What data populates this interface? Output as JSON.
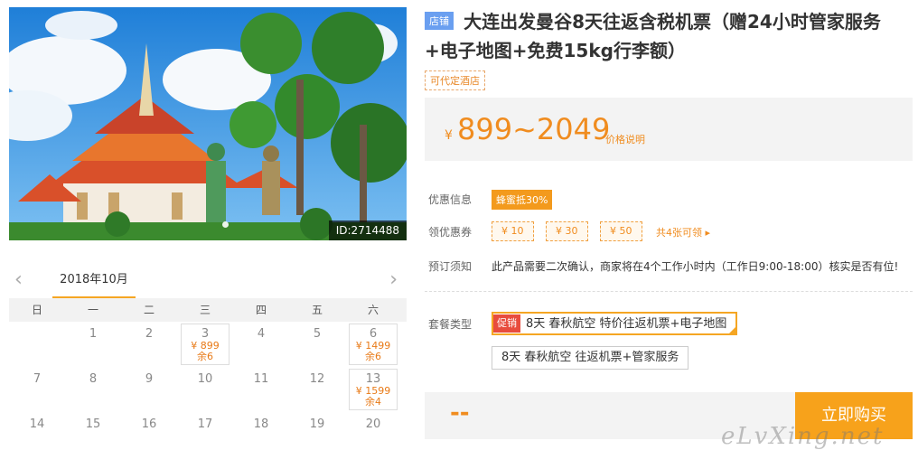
{
  "photo": {
    "id_label": "ID:2714488"
  },
  "calendar": {
    "month": "2018年10月",
    "prev": "‹",
    "next": "›",
    "weekdays": [
      "日",
      "一",
      "二",
      "三",
      "四",
      "五",
      "六"
    ],
    "days": [
      {
        "day": "",
        "price": "",
        "stock": ""
      },
      {
        "day": "1",
        "price": "",
        "stock": ""
      },
      {
        "day": "2",
        "price": "",
        "stock": ""
      },
      {
        "day": "3",
        "price": "¥ 899",
        "stock": "余6"
      },
      {
        "day": "4",
        "price": "",
        "stock": ""
      },
      {
        "day": "5",
        "price": "",
        "stock": ""
      },
      {
        "day": "6",
        "price": "¥ 1499",
        "stock": "余6"
      },
      {
        "day": "7",
        "price": "",
        "stock": ""
      },
      {
        "day": "8",
        "price": "",
        "stock": ""
      },
      {
        "day": "9",
        "price": "",
        "stock": ""
      },
      {
        "day": "10",
        "price": "",
        "stock": ""
      },
      {
        "day": "11",
        "price": "",
        "stock": ""
      },
      {
        "day": "12",
        "price": "",
        "stock": ""
      },
      {
        "day": "13",
        "price": "¥ 1599",
        "stock": "余4"
      },
      {
        "day": "14",
        "price": "",
        "stock": ""
      },
      {
        "day": "15",
        "price": "",
        "stock": ""
      },
      {
        "day": "16",
        "price": "",
        "stock": ""
      },
      {
        "day": "17",
        "price": "",
        "stock": ""
      },
      {
        "day": "18",
        "price": "",
        "stock": ""
      },
      {
        "day": "19",
        "price": "",
        "stock": ""
      },
      {
        "day": "20",
        "price": "",
        "stock": ""
      }
    ]
  },
  "product": {
    "store_badge": "店铺",
    "title": "大连出发曼谷8天往返含税机票（赠24小时管家服务+电子地图+免费15kg行李额）",
    "hotel_tag": "可代定酒店",
    "price_symbol": "¥",
    "price_range": "899~2049",
    "price_explain": "价格说明"
  },
  "offers": {
    "promo_label": "优惠信息",
    "promo_tag": "蜂蜜抵30%",
    "coupon_label": "领优惠券",
    "coupons": [
      "¥ 10",
      "¥ 30",
      "¥ 50"
    ],
    "coupon_more": "共4张可领 ▸",
    "notice_label": "预订须知",
    "notice_text": "此产品需要二次确认，商家将在4个工作小时内（工作日9:00-18:00）核实是否有位!"
  },
  "packages": {
    "label": "套餐类型",
    "sale_badge": "促销",
    "items": [
      "8天 春秋航空 特价往返机票+电子地图",
      "8天 春秋航空 往返机票+管家服务"
    ]
  },
  "buy": {
    "price": "--",
    "button": "立即购买"
  },
  "watermark": "eLvXing.net",
  "colors": {
    "accent": "#f7a21b",
    "price": "#f08c1f",
    "sale": "#e84c3d",
    "store": "#6a9ff0"
  }
}
